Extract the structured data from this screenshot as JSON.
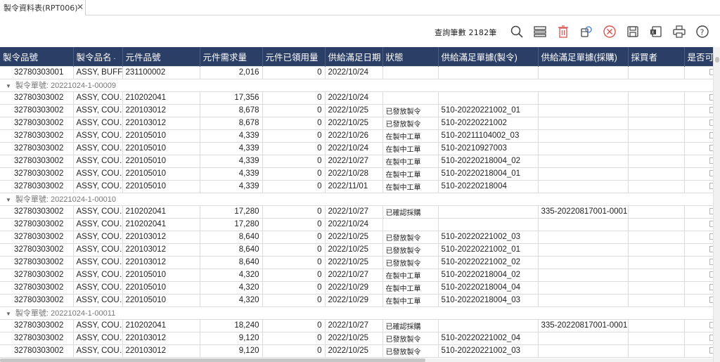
{
  "tab": {
    "title": "製令資料表(RPT006)",
    "close": "✕"
  },
  "toolbar": {
    "count_text": "查詢筆數 2182筆",
    "icons": [
      "search-icon",
      "list-view-icon",
      "delete-icon",
      "refresh-settings-icon",
      "cancel-icon",
      "save-icon",
      "export-icon",
      "print-icon",
      "help-icon"
    ]
  },
  "columns": [
    "製令品號",
    "製令品名",
    "元件品號",
    "元件需求量",
    "元件已領用量",
    "供給滿足日期",
    "狀態",
    "供給滿足單據(製令)",
    "供給滿足單據(採購)",
    "採買者",
    "是否可"
  ],
  "sort_mark": "-",
  "group_caret": "▼",
  "rows": [
    {
      "type": "row",
      "c": [
        "32780303001",
        "ASSY, BUFF…",
        "231100002",
        "2,016",
        "0",
        "2022/10/24",
        "",
        "",
        "",
        "",
        ""
      ]
    },
    {
      "type": "group",
      "label": "製令單號: 20221024-1-00009"
    },
    {
      "type": "row",
      "c": [
        "32780303002",
        "ASSY, COU…",
        "210202041",
        "17,356",
        "0",
        "2022/10/24",
        "",
        "",
        "",
        "",
        ""
      ]
    },
    {
      "type": "row",
      "c": [
        "32780303002",
        "ASSY, COU…",
        "220103012",
        "8,678",
        "0",
        "2022/10/25",
        "已發放製令",
        "510-20220221002_01",
        "",
        "",
        ""
      ]
    },
    {
      "type": "row",
      "c": [
        "32780303002",
        "ASSY, COU…",
        "220103012",
        "8,678",
        "0",
        "2022/10/25",
        "已發放製令",
        "510-20220221002",
        "",
        "",
        ""
      ]
    },
    {
      "type": "row",
      "c": [
        "32780303002",
        "ASSY, COU…",
        "220105010",
        "4,339",
        "0",
        "2022/10/26",
        "在製中工單",
        "510-20211104002_03",
        "",
        "",
        ""
      ]
    },
    {
      "type": "row",
      "c": [
        "32780303002",
        "ASSY, COU…",
        "220105010",
        "4,339",
        "0",
        "2022/10/24",
        "在製中工單",
        "510-20210927003",
        "",
        "",
        ""
      ]
    },
    {
      "type": "row",
      "c": [
        "32780303002",
        "ASSY, COU…",
        "220105010",
        "4,339",
        "0",
        "2022/10/27",
        "在製中工單",
        "510-20220218004_02",
        "",
        "",
        ""
      ]
    },
    {
      "type": "row",
      "c": [
        "32780303002",
        "ASSY, COU…",
        "220105010",
        "4,339",
        "0",
        "2022/10/28",
        "在製中工單",
        "510-20220218004_01",
        "",
        "",
        ""
      ]
    },
    {
      "type": "row",
      "c": [
        "32780303002",
        "ASSY, COU…",
        "220105010",
        "4,339",
        "0",
        "2022/11/01",
        "在製中工單",
        "510-20220218004",
        "",
        "",
        ""
      ]
    },
    {
      "type": "group",
      "label": "製令單號: 20221024-1-00010"
    },
    {
      "type": "row",
      "c": [
        "32780303002",
        "ASSY, COU…",
        "210202041",
        "17,280",
        "0",
        "2022/10/27",
        "已確認採購",
        "",
        "335-20220817001-0001",
        "",
        ""
      ]
    },
    {
      "type": "row",
      "c": [
        "32780303002",
        "ASSY, COU…",
        "210202041",
        "17,280",
        "0",
        "2022/10/24",
        "",
        "",
        "",
        "",
        ""
      ]
    },
    {
      "type": "row",
      "c": [
        "32780303002",
        "ASSY, COU…",
        "220103012",
        "8,640",
        "0",
        "2022/10/25",
        "已發放製令",
        "510-20220221002_03",
        "",
        "",
        ""
      ]
    },
    {
      "type": "row",
      "c": [
        "32780303002",
        "ASSY, COU…",
        "220103012",
        "8,640",
        "0",
        "2022/10/25",
        "已發放製令",
        "510-20220221002_01",
        "",
        "",
        ""
      ]
    },
    {
      "type": "row",
      "c": [
        "32780303002",
        "ASSY, COU…",
        "220103012",
        "8,640",
        "0",
        "2022/10/25",
        "已發放製令",
        "510-20220221002_02",
        "",
        "",
        ""
      ]
    },
    {
      "type": "row",
      "c": [
        "32780303002",
        "ASSY, COU…",
        "220105010",
        "4,320",
        "0",
        "2022/10/27",
        "在製中工單",
        "510-20220218004_02",
        "",
        "",
        ""
      ]
    },
    {
      "type": "row",
      "c": [
        "32780303002",
        "ASSY, COU…",
        "220105010",
        "4,320",
        "0",
        "2022/10/29",
        "在製中工單",
        "510-20220218004_04",
        "",
        "",
        ""
      ]
    },
    {
      "type": "row",
      "c": [
        "32780303002",
        "ASSY, COU…",
        "220105010",
        "4,320",
        "0",
        "2022/10/29",
        "在製中工單",
        "510-20220218004_03",
        "",
        "",
        ""
      ]
    },
    {
      "type": "group",
      "label": "製令單號: 20221024-1-00011"
    },
    {
      "type": "row",
      "c": [
        "32780303002",
        "ASSY, COU…",
        "210202041",
        "18,240",
        "0",
        "2022/10/27",
        "已確認採購",
        "",
        "335-20220817001-0001",
        "",
        ""
      ]
    },
    {
      "type": "row",
      "c": [
        "32780303002",
        "ASSY, COU…",
        "220103012",
        "9,120",
        "0",
        "2022/10/25",
        "已發放製令",
        "510-20220221002_04",
        "",
        "",
        ""
      ]
    },
    {
      "type": "row",
      "c": [
        "32780303002",
        "ASSY, COU…",
        "220103012",
        "9,120",
        "0",
        "2022/10/25",
        "已發放製令",
        "510-20220221002_03",
        "",
        "",
        ""
      ]
    }
  ]
}
